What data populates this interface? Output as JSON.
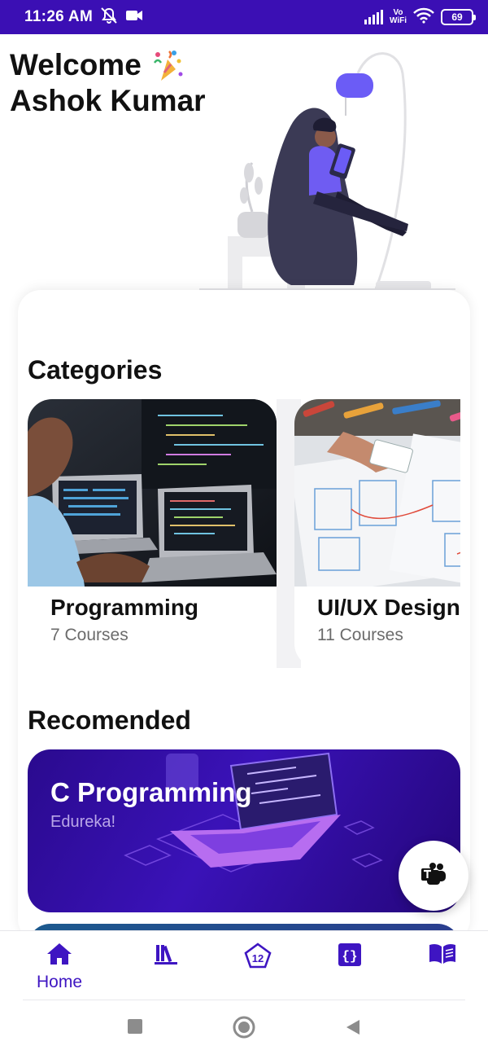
{
  "status_bar": {
    "time": "11:26 AM",
    "network_label_top": "Vo",
    "network_label_bottom": "WiFi",
    "battery": "69",
    "icons": [
      "mute-icon",
      "video-icon",
      "signal-icon",
      "wifi-icon",
      "battery-icon"
    ]
  },
  "header": {
    "welcome": "Welcome",
    "user_name": "Ashok Kumar",
    "party_icon": "party-popper-icon"
  },
  "categories": {
    "title": "Categories",
    "items": [
      {
        "name": "Programming",
        "count": "7 Courses"
      },
      {
        "name": "UI/UX Design",
        "count": "11 Courses"
      }
    ]
  },
  "recommended": {
    "title": "Recomended",
    "items": [
      {
        "title": "C Programming",
        "provider": "Edureka!"
      }
    ]
  },
  "fab": {
    "icon": "teams-icon"
  },
  "bottom_nav": {
    "items": [
      {
        "label": "Home",
        "icon": "home-icon",
        "active": true
      },
      {
        "label": "",
        "icon": "library-icon",
        "active": false
      },
      {
        "label": "",
        "icon": "pentagon-12-icon",
        "active": false
      },
      {
        "label": "",
        "icon": "code-braces-icon",
        "active": false
      },
      {
        "label": "",
        "icon": "book-open-icon",
        "active": false
      }
    ]
  },
  "colors": {
    "primary": "#3e15c2",
    "status_bar": "#3b0fb4",
    "text_dark": "#111111",
    "text_muted": "#6b6b6b"
  }
}
